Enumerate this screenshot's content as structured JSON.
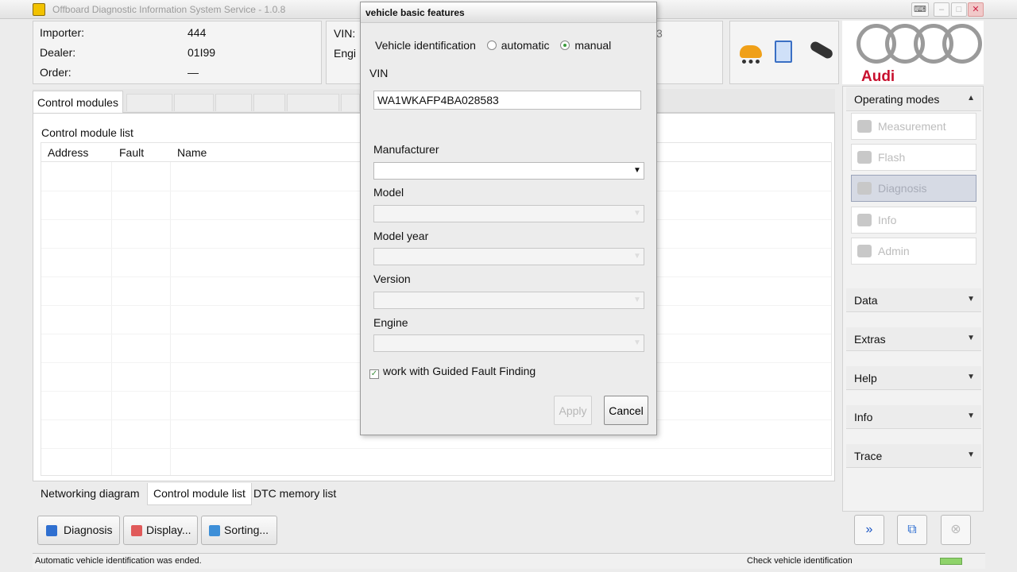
{
  "window": {
    "title": "Offboard Diagnostic Information System Service - 1.0.8",
    "icons": [
      "app-icon",
      "keyboard-icon",
      "minimize-icon",
      "maximize-icon",
      "close-icon"
    ]
  },
  "header": {
    "importer_label": "Importer:",
    "importer_value": "444",
    "dealer_label": "Dealer:",
    "dealer_value": "01I99",
    "order_label": "Order:",
    "order_value": "—",
    "vin_label": "VIN:",
    "engine_label": "Engi",
    "vin_tail": "3",
    "brand": "Audi"
  },
  "tabs": {
    "active": "Control modules"
  },
  "main": {
    "list_title": "Control module list",
    "columns": [
      "Address",
      "Fault",
      "Name"
    ]
  },
  "bottom_tabs": [
    "Networking diagram",
    "Control module list",
    "DTC memory list"
  ],
  "actions": {
    "diagnosis": "Diagnosis",
    "display": "Display...",
    "sorting": "Sorting..."
  },
  "sidebar": {
    "operating_modes": "Operating modes",
    "items": [
      "Measurement",
      "Flash",
      "Diagnosis",
      "Info",
      "Admin"
    ],
    "sections": [
      "Data",
      "Extras",
      "Help",
      "Info",
      "Trace"
    ],
    "footer_icons": [
      "fast-forward-icon",
      "fit-window-icon",
      "stop-icon"
    ]
  },
  "status": {
    "left": "Automatic vehicle identification was ended.",
    "right": "Check vehicle identification"
  },
  "dialog": {
    "title": "vehicle basic features",
    "vehicle_identification_label": "Vehicle identification",
    "option_automatic": "automatic",
    "option_manual": "manual",
    "selected_option": "manual",
    "vin_label": "VIN",
    "vin_value": "WA1WKAFP4BA028583",
    "manufacturer_label": "Manufacturer",
    "model_label": "Model",
    "model_year_label": "Model year",
    "version_label": "Version",
    "engine_label": "Engine",
    "guided_fault_finding": "work with Guided Fault Finding",
    "guided_fault_finding_checked": true,
    "apply": "Apply",
    "cancel": "Cancel"
  },
  "colors": {
    "brand_red": "#c8102e",
    "selected_item_bg": "#d6dae4",
    "radio_selected": "#3c9b3c"
  }
}
